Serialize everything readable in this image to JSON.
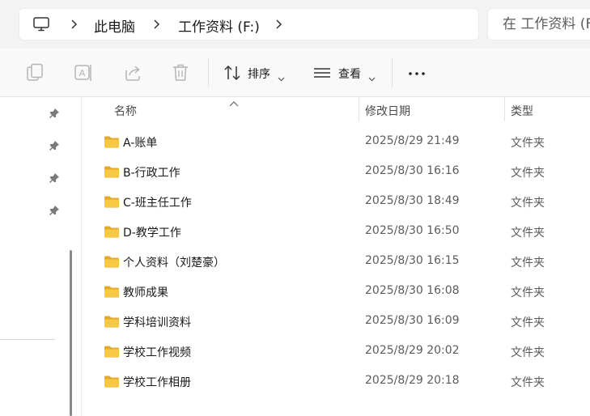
{
  "address_bar": {
    "breadcrumbs": [
      "此电脑",
      "工作资料 (F:)"
    ],
    "computer_icon": "computer-icon"
  },
  "search": {
    "placeholder": "在 工作资料 (F:)"
  },
  "toolbar": {
    "sort_label": "排序",
    "view_label": "查看",
    "more_label": "•••",
    "icons": [
      "copy-icon",
      "rename-icon",
      "share-icon",
      "delete-icon",
      "sort-icon",
      "view-icon",
      "more-icon"
    ]
  },
  "columns": {
    "name": "名称",
    "date": "修改日期",
    "type": "类型"
  },
  "files": [
    {
      "name": "A-账单",
      "date": "2025/8/29 21:49",
      "type": "文件夹"
    },
    {
      "name": "B-行政工作",
      "date": "2025/8/30 16:16",
      "type": "文件夹"
    },
    {
      "name": "C-班主任工作",
      "date": "2025/8/30 18:49",
      "type": "文件夹"
    },
    {
      "name": "D-教学工作",
      "date": "2025/8/30 16:50",
      "type": "文件夹"
    },
    {
      "name": "个人资料（刘楚豪）",
      "date": "2025/8/30 16:15",
      "type": "文件夹"
    },
    {
      "name": "教师成果",
      "date": "2025/8/30 16:08",
      "type": "文件夹"
    },
    {
      "name": "学科培训资料",
      "date": "2025/8/30 16:09",
      "type": "文件夹"
    },
    {
      "name": "学校工作视频",
      "date": "2025/8/29 20:02",
      "type": "文件夹"
    },
    {
      "name": "学校工作相册",
      "date": "2025/8/29 20:18",
      "type": "文件夹"
    }
  ],
  "colors": {
    "folder": "#f7c842",
    "folder_tab": "#e7a92b",
    "accent": "#0067c0"
  }
}
